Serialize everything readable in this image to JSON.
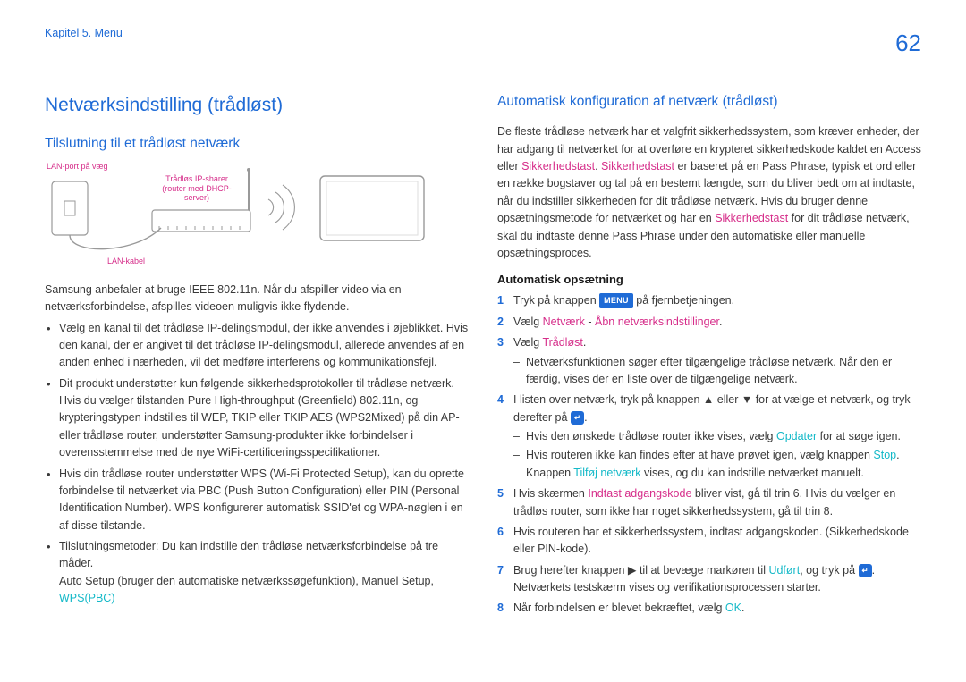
{
  "header": {
    "chapter": "Kapitel 5. Menu",
    "pageNumber": "62"
  },
  "left": {
    "h1": "Netværksindstilling (trådløst)",
    "h2": "Tilslutning til et trådløst netværk",
    "diagram": {
      "lanPort": "LAN-port på væg",
      "sharer1": "Trådløs IP-sharer",
      "sharer2": "(router med DHCP-",
      "sharer3": "server)",
      "cable": "LAN-kabel"
    },
    "intro": "Samsung anbefaler at bruge IEEE 802.11n. Når du afspiller video via en netværksforbindelse, afspilles videoen muligvis ikke flydende.",
    "bullets": [
      {
        "line1": "Vælg en kanal til det trådløse IP-delingsmodul, der ikke anvendes i øjeblikket. Hvis den kanal, der er angivet til det trådløse IP-delingsmodul, allerede anvendes af en anden enhed i nærheden, vil det medføre interferens og kommunikationsfejl."
      },
      {
        "line1": "Dit produkt understøtter kun følgende sikkerhedsprotokoller til trådløse netværk.",
        "cont": "Hvis du vælger tilstanden Pure High-throughput (Greenfield) 802.11n, og krypteringstypen indstilles til WEP, TKIP eller TKIP AES (WPS2Mixed) på din AP- eller trådløse router, understøtter Samsung-produkter ikke forbindelser i overensstemmelse med de nye WiFi-certificeringsspecifikationer."
      },
      {
        "line1": "Hvis din trådløse router understøtter WPS (Wi-Fi Protected Setup), kan du oprette forbindelse til netværket via PBC (Push Button Configuration) eller PIN (Personal Identification Number). WPS konfigurerer automatisk SSID'et og WPA-nøglen i en af disse tilstande."
      },
      {
        "line1_pre": "Tilslutningsmetoder: Du kan indstille den trådløse netværksforbindelse på tre måder.",
        "cont_pre": "Auto Setup (bruger den automatiske netværkssøgefunktion), Manuel Setup, ",
        "wps": "WPS(PBC)"
      }
    ]
  },
  "right": {
    "h2": "Automatisk konfiguration af netværk (trådløst)",
    "p1_a": "De fleste trådløse netværk har et valgfrit sikkerhedssystem, som kræver enheder, der har adgang til netværket for at overføre en krypteret sikkerhedskode kaldet en Access eller ",
    "p1_sec1": "Sikkerhedstast",
    "p1_b": ". ",
    "p1_sec2": "Sikkerhedstast",
    "p1_c": " er baseret på en Pass Phrase, typisk et ord eller en række bogstaver og tal på en bestemt længde, som du bliver bedt om at indtaste, når du indstiller sikkerheden for dit trådløse netværk. Hvis du bruger denne opsætningsmetode for netværket og har en ",
    "p1_sec3": "Sikkerhedstast",
    "p1_d": " for dit trådløse netværk, skal du indtaste denne Pass Phrase under den automatiske eller manuelle opsætningsproces.",
    "h3": "Automatisk opsætning",
    "steps": [
      {
        "a": "Tryk på knappen ",
        "pill": "MENU",
        "b": " på fjernbetjeningen."
      },
      {
        "a": "Vælg ",
        "m1": "Netværk",
        "b": " - ",
        "m2": "Åbn netværksindstillinger",
        "c": "."
      },
      {
        "a": "Vælg ",
        "m1": "Trådløst",
        "b": ".",
        "sub": [
          {
            "text": "Netværksfunktionen søger efter tilgængelige trådløse netværk. Når den er færdig, vises der en liste over de tilgængelige netværk."
          }
        ]
      },
      {
        "a": "I listen over netværk, tryk på knappen ▲ eller ▼ for at vælge et netværk, og tryk derefter på ",
        "enterPill": "↵",
        "b": ".",
        "sub": [
          {
            "pre": "Hvis den ønskede trådløse router ikke vises, vælg ",
            "cy1": "Opdater",
            "post": " for at søge igen."
          },
          {
            "pre": "Hvis routeren ikke kan findes efter at have prøvet igen, vælg knappen ",
            "cy1": "Stop",
            "mid": ". Knappen ",
            "cy2": "Tilføj netværk",
            "post": " vises, og du kan indstille netværket manuelt."
          }
        ]
      },
      {
        "a": "Hvis skærmen ",
        "m1": "Indtast adgangskode",
        "b": " bliver vist, gå til trin 6. Hvis du vælger en trådløs router, som ikke har noget sikkerhedssystem, gå til trin 8."
      },
      {
        "a": "Hvis routeren har et sikkerhedssystem, indtast adgangskoden. (Sikkerhedskode eller PIN-kode)."
      },
      {
        "a": "Brug herefter knappen ▶ til at bevæge markøren til ",
        "cy1": "Udført",
        "b": ", og tryk på ",
        "enterPill": "↵",
        "c": ". Netværkets testskærm vises og verifikationsprocessen starter."
      },
      {
        "a": "Når forbindelsen er blevet bekræftet, vælg ",
        "cy1": "OK",
        "b": "."
      }
    ]
  }
}
